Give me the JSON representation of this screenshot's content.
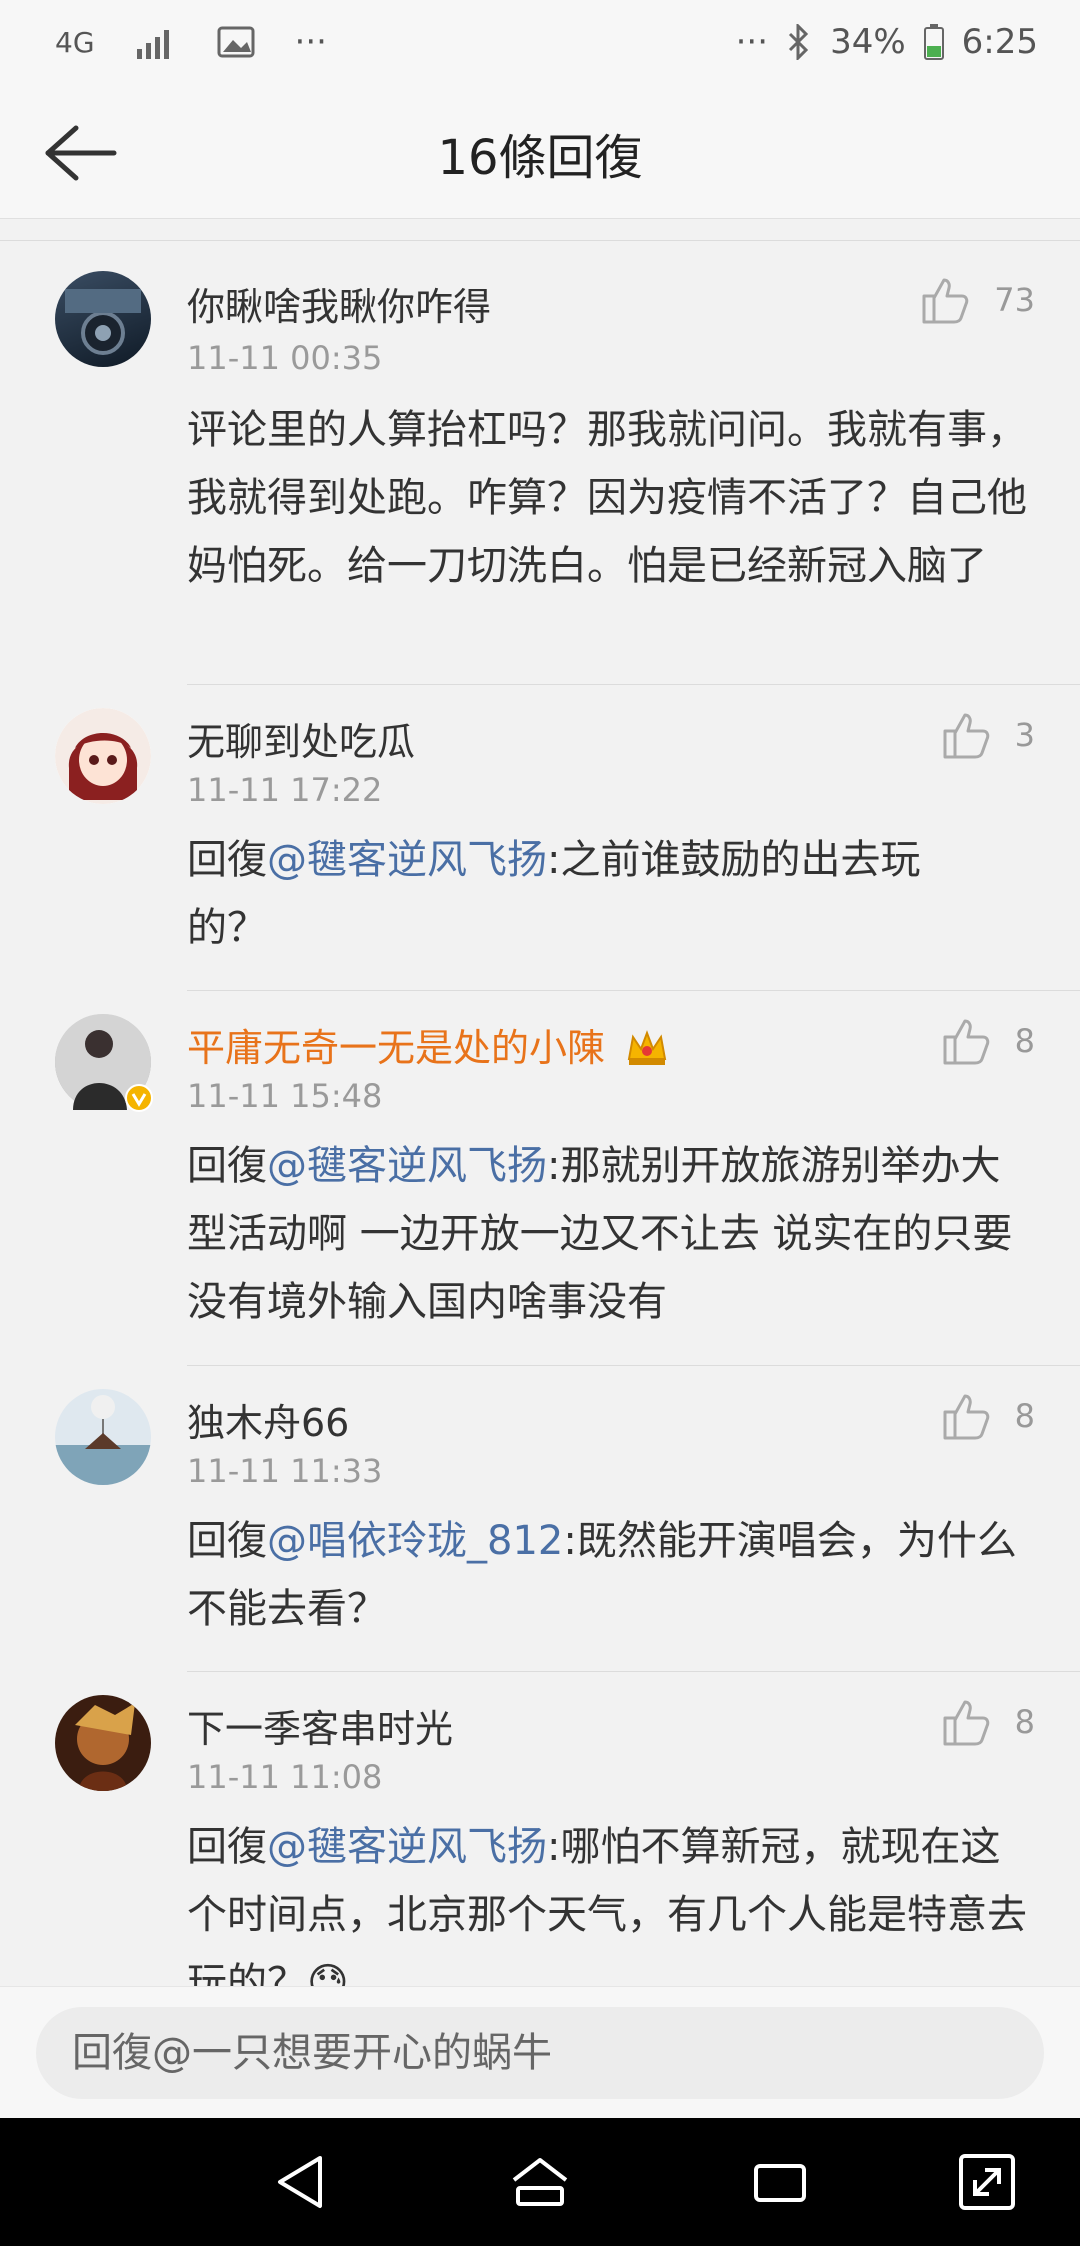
{
  "status_bar": {
    "network": "4G",
    "battery": "34%",
    "time": "6:25",
    "dots": "···"
  },
  "header": {
    "title": "16條回復"
  },
  "comments": [
    {
      "username": "你瞅啥我瞅你咋得",
      "time": "11-11 00:35",
      "likes": "73",
      "text": "评论里的人算抬杠吗？那我就问问。我就有事，我就得到处跑。咋算？因为疫情不活了？自己他妈怕死。给一刀切洗白。怕是已经新冠入脑了",
      "avatar_color": "#2c3e50"
    },
    {
      "username": "无聊到处吃瓜",
      "time": "11-11 17:22",
      "likes": "3",
      "reply_prefix": "回復",
      "mention": "@毽客逆风飞扬",
      "text": ":之前谁鼓励的出去玩的？",
      "avatar_color": "#e7c9c9"
    },
    {
      "username": "平庸无奇一无是处的小陳",
      "time": "11-11 15:48",
      "likes": "8",
      "reply_prefix": "回復",
      "mention": "@毽客逆风飞扬",
      "text": ":那就别开放旅游别举办大型活动啊 一边开放一边又不让去 说实在的只要没有境外输入国内啥事没有",
      "avatar_color": "#6b6b6b"
    },
    {
      "username": "独木舟66",
      "time": "11-11 11:33",
      "likes": "8",
      "reply_prefix": "回復",
      "mention": "@唱依玲珑_812",
      "text": ":既然能开演唱会，为什么不能去看？",
      "avatar_color": "#9fb7c9"
    },
    {
      "username": "下一季客串时光",
      "time": "11-11 11:08",
      "likes": "8",
      "reply_prefix": "回復",
      "mention": "@毽客逆风飞扬",
      "text": ":哪怕不算新冠，就现在这个时间点，北京那个天气，有几个人能是特意去玩的？😓",
      "avatar_color": "#8a4b2a"
    }
  ],
  "reply_bar": {
    "placeholder": "回復@一只想要开心的蜗牛"
  },
  "colors": {
    "accent_mention": "#4a6fa5",
    "vip_name": "#e8731a",
    "background": "#f2f2f2"
  }
}
